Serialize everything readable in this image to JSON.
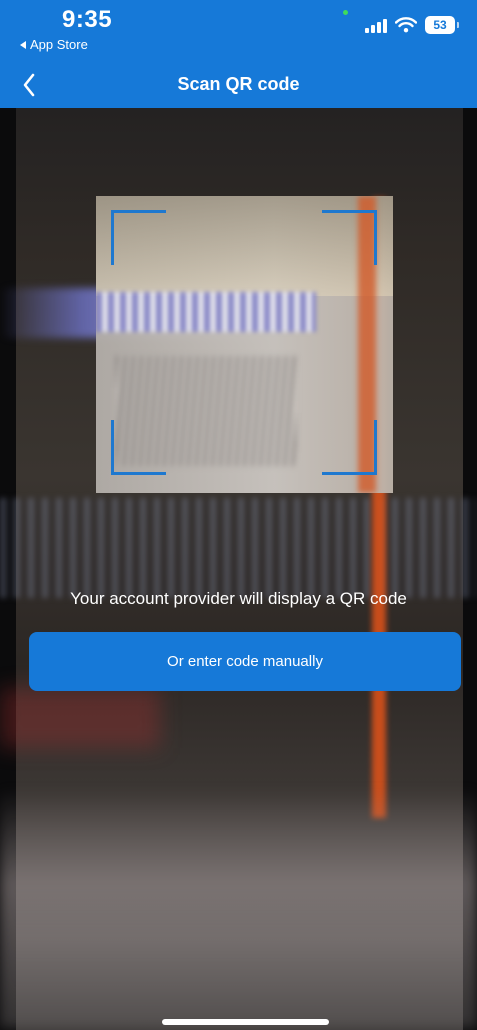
{
  "status_bar": {
    "time": "9:35",
    "back_app": "App Store",
    "battery": "53"
  },
  "nav": {
    "title": "Scan QR code",
    "back_icon": "chevron-left-icon"
  },
  "scanner": {
    "instruction": "Your account provider will display a QR code",
    "manual_button_label": "Or enter code manually"
  },
  "colors": {
    "accent": "#1679d8",
    "frame_corner": "#1e78cf"
  }
}
